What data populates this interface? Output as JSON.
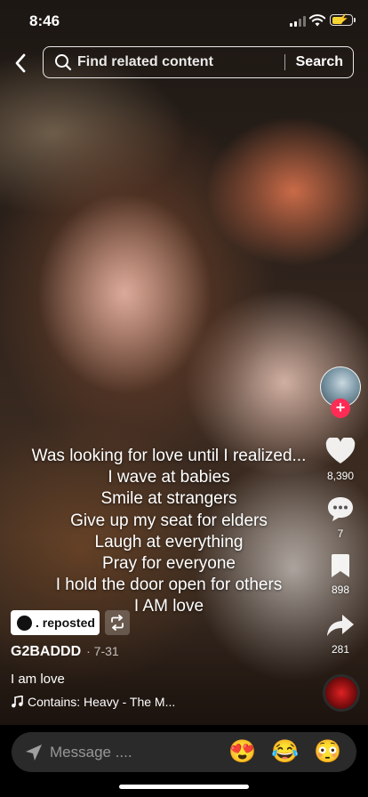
{
  "status_bar": {
    "time": "8:46"
  },
  "header": {
    "search_placeholder": "Find related content",
    "search_button": "Search"
  },
  "caption_lines": [
    "Was looking for love until I realized...",
    "I wave at babies",
    "Smile at strangers",
    "Give up my seat for elders",
    "Laugh at everything",
    "Pray for everyone",
    "I hold the door open for others",
    "I AM love"
  ],
  "rail": {
    "likes": "8,390",
    "comments": "7",
    "saves": "898",
    "shares": "281"
  },
  "post": {
    "repost_label": ". reposted",
    "author": "G2BADDD",
    "date": "· 7-31",
    "description": "I am love",
    "sound": "Contains: Heavy - The M..."
  },
  "message_bar": {
    "placeholder": "Message ....",
    "emojis": [
      "😍",
      "😂",
      "😳"
    ]
  },
  "colors": {
    "follow_badge": "#fe2c55",
    "battery": "#f5d533"
  }
}
